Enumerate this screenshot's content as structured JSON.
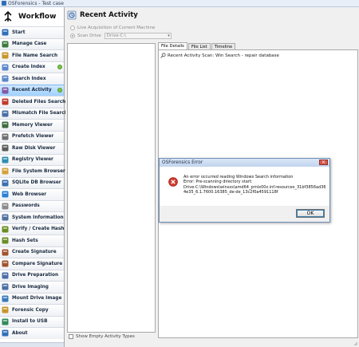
{
  "app": {
    "title": "OSForensics - Test case"
  },
  "workflow": {
    "title": "Workflow",
    "items": [
      {
        "label": "Start",
        "icon": "start-icon",
        "color": "#2f6fb8"
      },
      {
        "label": "Manage Case",
        "icon": "manage-case-icon",
        "color": "#3a7a3a"
      },
      {
        "label": "File Name Search",
        "icon": "file-search-icon",
        "color": "#c7962a"
      },
      {
        "label": "Create Index",
        "icon": "create-index-icon",
        "color": "#5b88c9",
        "status": true
      },
      {
        "label": "Search Index",
        "icon": "search-index-icon",
        "color": "#5b88c9"
      },
      {
        "label": "Recent Activity",
        "icon": "recent-activity-icon",
        "color": "#7f5aa8",
        "active": true,
        "status": true
      },
      {
        "label": "Deleted Files Search",
        "icon": "deleted-files-icon",
        "color": "#c0392b"
      },
      {
        "label": "Mismatch File Search",
        "icon": "mismatch-file-icon",
        "color": "#4a6fa5"
      },
      {
        "label": "Memory Viewer",
        "icon": "memory-icon",
        "color": "#3e6d3e"
      },
      {
        "label": "Prefetch Viewer",
        "icon": "prefetch-icon",
        "color": "#6f6f6f"
      },
      {
        "label": "Raw Disk Viewer",
        "icon": "raw-disk-icon",
        "color": "#5a5a5a"
      },
      {
        "label": "Registry Viewer",
        "icon": "registry-icon",
        "color": "#2e8fb0"
      },
      {
        "label": "File System Browser",
        "icon": "file-system-icon",
        "color": "#d4a23a"
      },
      {
        "label": "SQLite DB Browser",
        "icon": "sqlite-icon",
        "color": "#3a6fb0"
      },
      {
        "label": "Web Browser",
        "icon": "web-browser-icon",
        "color": "#2b7fd4"
      },
      {
        "label": "Passwords",
        "icon": "passwords-icon",
        "color": "#8a8a8a"
      },
      {
        "label": "System Information",
        "icon": "system-info-icon",
        "color": "#4f6f9f"
      },
      {
        "label": "Verify / Create Hash",
        "icon": "hash-icon",
        "color": "#6b8e23"
      },
      {
        "label": "Hash Sets",
        "icon": "hash-sets-icon",
        "color": "#6b8e23"
      },
      {
        "label": "Create Signature",
        "icon": "create-signature-icon",
        "color": "#a0522d"
      },
      {
        "label": "Compare Signature",
        "icon": "compare-signature-icon",
        "color": "#a0522d"
      },
      {
        "label": "Drive Preparation",
        "icon": "drive-prep-icon",
        "color": "#4a6fa5"
      },
      {
        "label": "Drive Imaging",
        "icon": "drive-imaging-icon",
        "color": "#4a6fa5"
      },
      {
        "label": "Mount Drive Image",
        "icon": "mount-drive-icon",
        "color": "#3a7ab8"
      },
      {
        "label": "Forensic Copy",
        "icon": "forensic-copy-icon",
        "color": "#c7962a"
      },
      {
        "label": "Install to USB",
        "icon": "usb-icon",
        "color": "#2e8b57"
      },
      {
        "label": "About",
        "icon": "about-icon",
        "color": "#2f6fb8"
      }
    ]
  },
  "main": {
    "title": "Recent Activity",
    "live_acquisition_label": "Live Acquisition of Current Machine",
    "scan_drive_label": "Scan Drive",
    "scan_drive_value": "Drive-C:\\",
    "show_empty_label": "Show Empty Activity Types",
    "tabs": [
      {
        "label": "File Details"
      },
      {
        "label": "File List"
      },
      {
        "label": "Timeline"
      }
    ],
    "detail_line": "Recent Activity Scan: Win Search - repair database"
  },
  "dialog": {
    "title": "OSForensics Error",
    "message": "An error occurred reading Windows Search information\nError: Pre-scanning directory start:\nDrive-C:\\Windows\\winsxs\\amd64_prnlx00z.inf.resources_31bf3856ad36\n4e35_6.1.7600.16385_de-de_13c2f0a4591118f",
    "ok_label": "OK"
  }
}
